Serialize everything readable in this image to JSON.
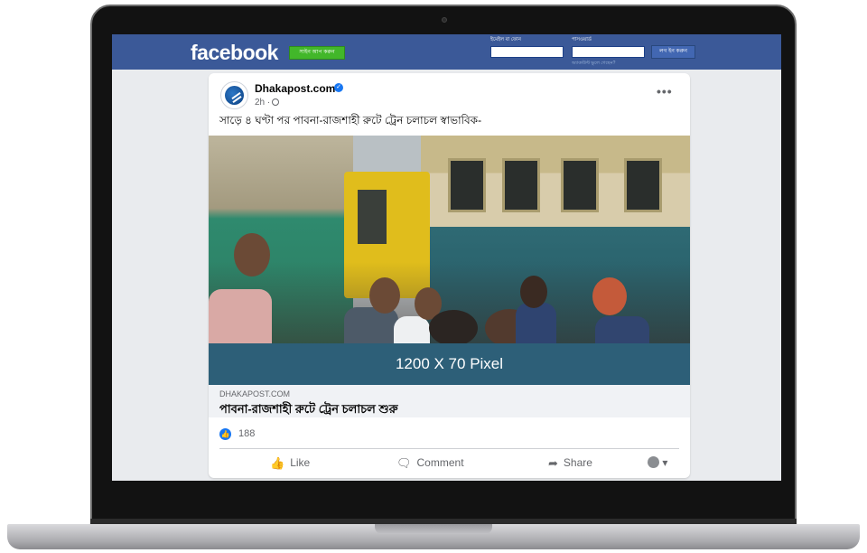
{
  "header": {
    "logo": "facebook",
    "signup_label": "সাইন আপ করুন",
    "email_label": "ইমেইল বা ফোন",
    "password_label": "পাসওয়ার্ড",
    "login_label": "লগ ইন করুন",
    "forgot_label": "অ্যাকাউন্ট ভুলে গেছেন?"
  },
  "post": {
    "page_name": "Dhakapost.com",
    "time": "2h ·",
    "more": "•••",
    "text": "সাড়ে ৪ ঘণ্টা পর পাবনা-রাজশাহী রুটে ট্রেন চলাচল স্বাভাবিক-",
    "banner": "1200 X 70 Pixel",
    "link_domain": "DHAKAPOST.COM",
    "link_title": "পাবনা-রাজশাহী রুটে ট্রেন চলাচল শুরু",
    "reaction_count": "188",
    "actions": {
      "like": "Like",
      "comment": "Comment",
      "share": "Share"
    }
  },
  "icons": {
    "like": "thumbs-up-icon",
    "comment": "comment-icon",
    "share": "share-icon",
    "verified": "verified-badge-icon",
    "globe": "globe-icon",
    "more": "more-options-icon"
  },
  "colors": {
    "facebook_blue": "#3b5998",
    "signup_green": "#42b72a",
    "banner": "#2d5f78",
    "like_blue": "#1877f2"
  }
}
